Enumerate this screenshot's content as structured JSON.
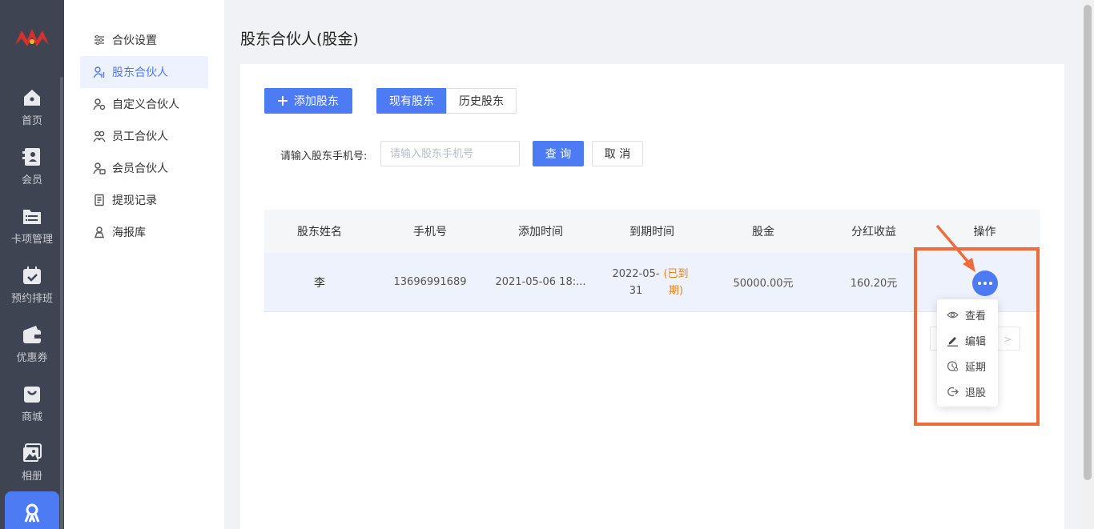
{
  "rail": {
    "items": [
      {
        "label": "首页",
        "icon": "home-icon"
      },
      {
        "label": "会员",
        "icon": "member-icon"
      },
      {
        "label": "卡项管理",
        "icon": "folder-list-icon"
      },
      {
        "label": "预约排班",
        "icon": "calendar-icon"
      },
      {
        "label": "优惠券",
        "icon": "wallet-icon"
      },
      {
        "label": "商城",
        "icon": "shopping-bag-icon"
      },
      {
        "label": "相册",
        "icon": "photo-icon"
      }
    ],
    "active_icon": "partner-icon"
  },
  "submenu": {
    "items": [
      {
        "label": "合伙设置",
        "icon": "sliders-icon"
      },
      {
        "label": "股东合伙人",
        "icon": "shareholder-icon"
      },
      {
        "label": "自定义合伙人",
        "icon": "custom-partner-icon"
      },
      {
        "label": "员工合伙人",
        "icon": "staff-partner-icon"
      },
      {
        "label": "会员合伙人",
        "icon": "member-partner-icon"
      },
      {
        "label": "提现记录",
        "icon": "document-icon"
      },
      {
        "label": "海报库",
        "icon": "poster-icon"
      }
    ],
    "active_index": 1
  },
  "page": {
    "title": "股东合伙人(股金)"
  },
  "toolbar": {
    "add_label": "添加股东",
    "tab_current": "现有股东",
    "tab_history": "历史股东"
  },
  "search": {
    "label": "请输入股东手机号:",
    "placeholder": "请输入股东手机号",
    "value": "",
    "query_label": "查 询",
    "cancel_label": "取 消"
  },
  "table": {
    "columns": [
      "股东姓名",
      "手机号",
      "添加时间",
      "到期时间",
      "股金",
      "分红收益",
      "操作"
    ],
    "rows": [
      {
        "name": "李",
        "phone": "13696991689",
        "added": "2021-05-06 18:...",
        "expire_date": "2022-05-31",
        "expire_status": "(已到期)",
        "capital": "50000.00元",
        "dividend": "160.20元"
      }
    ]
  },
  "menu": {
    "items": [
      {
        "label": "查看",
        "icon": "eye-icon"
      },
      {
        "label": "编辑",
        "icon": "pencil-icon"
      },
      {
        "label": "延期",
        "icon": "clock-icon"
      },
      {
        "label": "退股",
        "icon": "exit-icon"
      }
    ]
  },
  "colors": {
    "primary": "#4d7bf3",
    "sidebar": "#3e4451",
    "warning": "#f08019",
    "annotation": "#f06b3a"
  }
}
